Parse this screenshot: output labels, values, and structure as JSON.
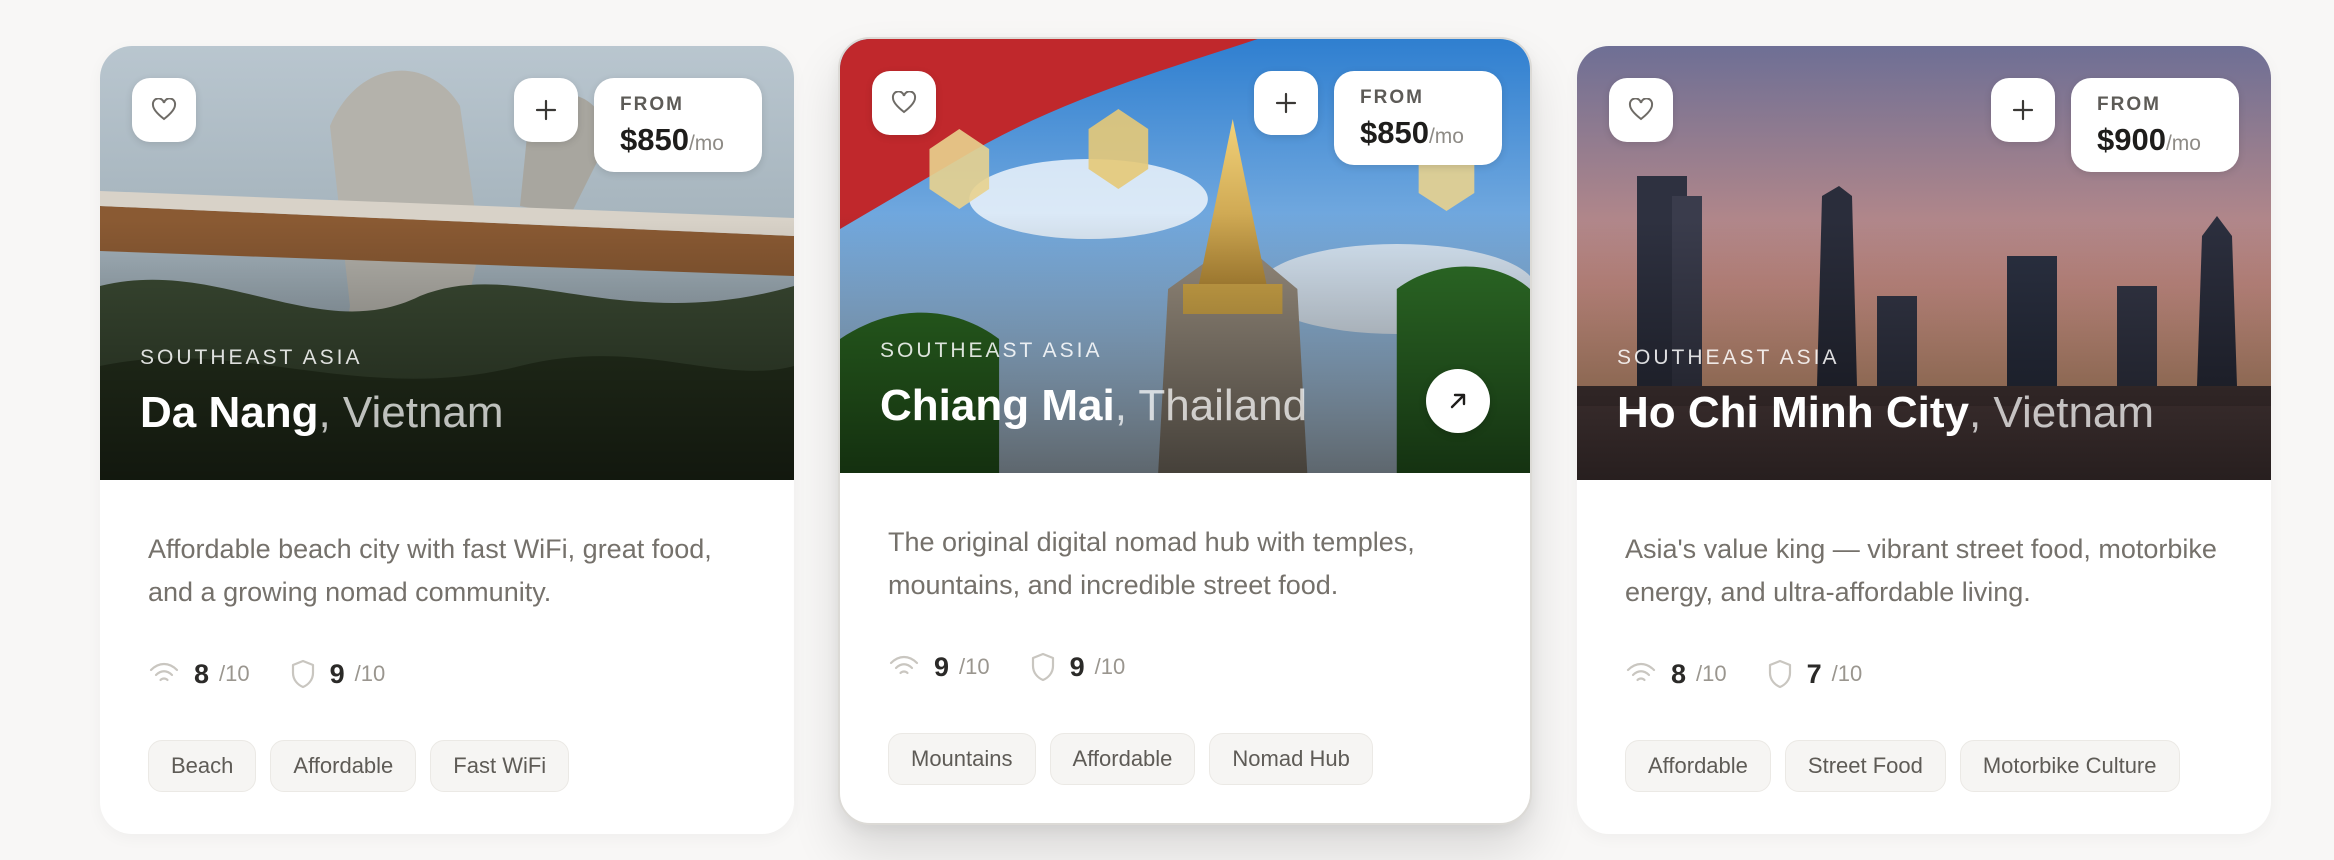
{
  "cards": [
    {
      "region": "SOUTHEAST ASIA",
      "city": "Da Nang",
      "country": ", Vietnam",
      "price_label": "FROM",
      "price": "$850",
      "price_unit": "/mo",
      "description": "Affordable beach city with fast WiFi, great food, and a growing nomad community.",
      "wifi_score": "8",
      "safety_score": "9",
      "score_max": "/10",
      "tags": [
        "Beach",
        "Affordable",
        "Fast WiFi"
      ]
    },
    {
      "region": "SOUTHEAST ASIA",
      "city": "Chiang Mai",
      "country": ", Thailand",
      "price_label": "FROM",
      "price": "$850",
      "price_unit": "/mo",
      "description": "The original digital nomad hub with temples, mountains, and incredible street food.",
      "wifi_score": "9",
      "safety_score": "9",
      "score_max": "/10",
      "tags": [
        "Mountains",
        "Affordable",
        "Nomad Hub"
      ]
    },
    {
      "region": "SOUTHEAST ASIA",
      "city": "Ho Chi Minh City",
      "country": ", Vietnam",
      "price_label": "FROM",
      "price": "$900",
      "price_unit": "/mo",
      "description": "Asia's value king — vibrant street food, motorbike energy, and ultra-affordable living.",
      "wifi_score": "8",
      "safety_score": "7",
      "score_max": "/10",
      "tags": [
        "Affordable",
        "Street Food",
        "Motorbike Culture"
      ]
    }
  ],
  "icons": {
    "favorite": "heart-icon",
    "add": "plus-icon",
    "open": "arrow-up-right-icon",
    "wifi": "wifi-icon",
    "safety": "shield-icon"
  }
}
